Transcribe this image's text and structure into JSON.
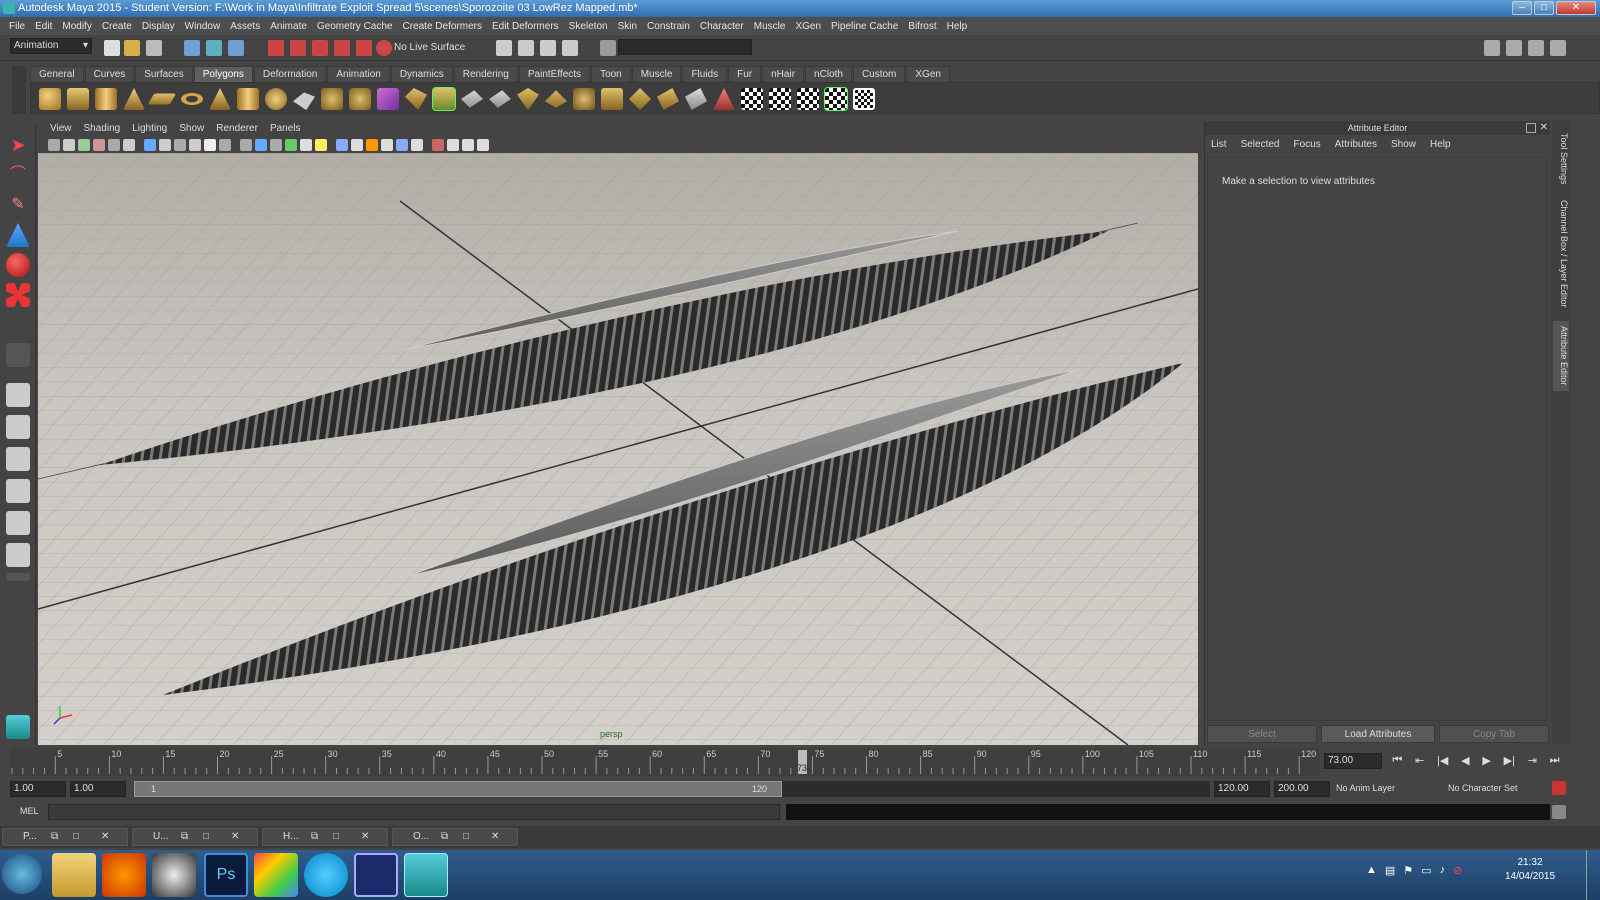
{
  "window": {
    "title": "Autodesk Maya 2015 - Student Version: F:\\Work in Maya\\Infiltrate Exploit Spread 5\\scenes\\Sporozoite 03 LowRez Mapped.mb*"
  },
  "menubar": [
    "File",
    "Edit",
    "Modify",
    "Create",
    "Display",
    "Window",
    "Assets",
    "Animate",
    "Geometry Cache",
    "Create Deformers",
    "Edit Deformers",
    "Skeleton",
    "Skin",
    "Constrain",
    "Character",
    "Muscle",
    "XGen",
    "Pipeline Cache",
    "Bifrost",
    "Help"
  ],
  "statusline": {
    "menu_set": "Animation",
    "live_surface": "No Live Surface"
  },
  "shelf_tabs": [
    "General",
    "Curves",
    "Surfaces",
    "Polygons",
    "Deformation",
    "Animation",
    "Dynamics",
    "Rendering",
    "PaintEffects",
    "Toon",
    "Muscle",
    "Fluids",
    "Fur",
    "nHair",
    "nCloth",
    "Custom",
    "XGen"
  ],
  "active_shelf_tab": "Polygons",
  "viewport": {
    "menu": [
      "View",
      "Shading",
      "Lighting",
      "Show",
      "Renderer",
      "Panels"
    ],
    "camera_label": "persp"
  },
  "attribute_editor": {
    "title": "Attribute Editor",
    "menu": [
      "List",
      "Selected",
      "Focus",
      "Attributes",
      "Show",
      "Help"
    ],
    "message": "Make a selection to view attributes",
    "buttons": {
      "select": "Select",
      "load": "Load Attributes",
      "copy": "Copy Tab"
    }
  },
  "side_tabs": [
    "Tool Settings",
    "Channel Box / Layer Editor",
    "Attribute Editor"
  ],
  "timeline": {
    "ticks": [
      "5",
      "10",
      "15",
      "20",
      "25",
      "30",
      "35",
      "40",
      "45",
      "50",
      "55",
      "60",
      "65",
      "70",
      "75",
      "80",
      "85",
      "90",
      "95",
      "100",
      "105",
      "110",
      "115",
      "120"
    ],
    "current_frame_marker": "73",
    "current_time": "73.00"
  },
  "range": {
    "start": "1.00",
    "playback_start": "1.00",
    "slider_start": "1",
    "slider_end": "120",
    "playback_end": "120.00",
    "end": "200.00",
    "anim_layer": "No Anim Layer",
    "character_set": "No Character Set"
  },
  "command_line": {
    "label": "MEL"
  },
  "maya_tasks": [
    "P...",
    "U...",
    "H...",
    "O..."
  ],
  "system_tray": {
    "time": "21:32",
    "date": "14/04/2015"
  },
  "colors": {
    "maya_teal": "#3bb3b0",
    "accent_blue": "#2f6db0"
  }
}
